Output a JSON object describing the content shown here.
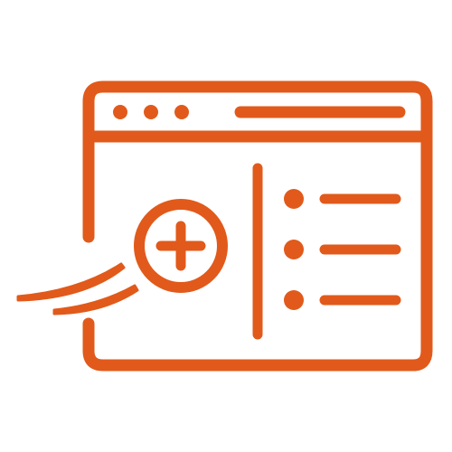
{
  "icon": {
    "name": "browser-window-add-list-icon",
    "color": "#E15A1B",
    "background": "#FFFFFF",
    "parts": {
      "window_dots": 3,
      "list_items": 3
    }
  }
}
